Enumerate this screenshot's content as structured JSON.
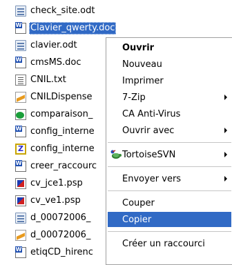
{
  "files": [
    {
      "name": "check_site.odt",
      "icon": "odt-file-icon",
      "selected": false
    },
    {
      "name": "Clavier_qwerty.doc",
      "icon": "word-doc-icon",
      "selected": true
    },
    {
      "name": "clavier.odt",
      "icon": "odt-file-icon",
      "selected": false
    },
    {
      "name": "cmsMS.doc",
      "icon": "word-doc-icon",
      "selected": false
    },
    {
      "name": "CNIL.txt",
      "icon": "text-file-icon",
      "selected": false
    },
    {
      "name": "CNILDispense",
      "icon": "pdf-file-icon",
      "selected": false
    },
    {
      "name": "comparaison_",
      "icon": "html-file-icon",
      "selected": false
    },
    {
      "name": "config_interne",
      "icon": "word-doc-icon",
      "selected": false
    },
    {
      "name": "config_interne",
      "icon": "z-file-icon",
      "selected": false
    },
    {
      "name": "creer_raccourc",
      "icon": "word-doc-icon",
      "selected": false
    },
    {
      "name": "cv_jce1.psp",
      "icon": "psp-file-icon",
      "selected": false
    },
    {
      "name": "cv_ve1.psp",
      "icon": "psp-file-icon",
      "selected": false
    },
    {
      "name": "d_00072006_",
      "icon": "odt-file-icon",
      "selected": false
    },
    {
      "name": "d_00072006_",
      "icon": "pdf-file-icon",
      "selected": false
    },
    {
      "name": "etiqCD_hirenc",
      "icon": "word-doc-icon",
      "selected": false
    }
  ],
  "context_menu": {
    "items": [
      {
        "label": "Ouvrir",
        "bold": true,
        "submenu": false
      },
      {
        "label": "Nouveau",
        "bold": false,
        "submenu": false
      },
      {
        "label": "Imprimer",
        "bold": false,
        "submenu": false
      },
      {
        "label": "7-Zip",
        "bold": false,
        "submenu": true
      },
      {
        "label": "CA Anti-Virus",
        "bold": false,
        "submenu": false
      },
      {
        "label": "Ouvrir avec",
        "bold": false,
        "submenu": true
      },
      {
        "label": "TortoiseSVN",
        "bold": false,
        "submenu": true,
        "icon": "tortoise-icon"
      },
      {
        "label": "Envoyer vers",
        "bold": false,
        "submenu": true
      },
      {
        "label": "Couper",
        "bold": false,
        "submenu": false
      },
      {
        "label": "Copier",
        "bold": false,
        "submenu": false,
        "highlighted": true
      },
      {
        "label": "Créer un raccourci",
        "bold": false,
        "submenu": false
      }
    ]
  },
  "colors": {
    "selection": "#316ac5",
    "menu_border": "#a0a0a0"
  }
}
